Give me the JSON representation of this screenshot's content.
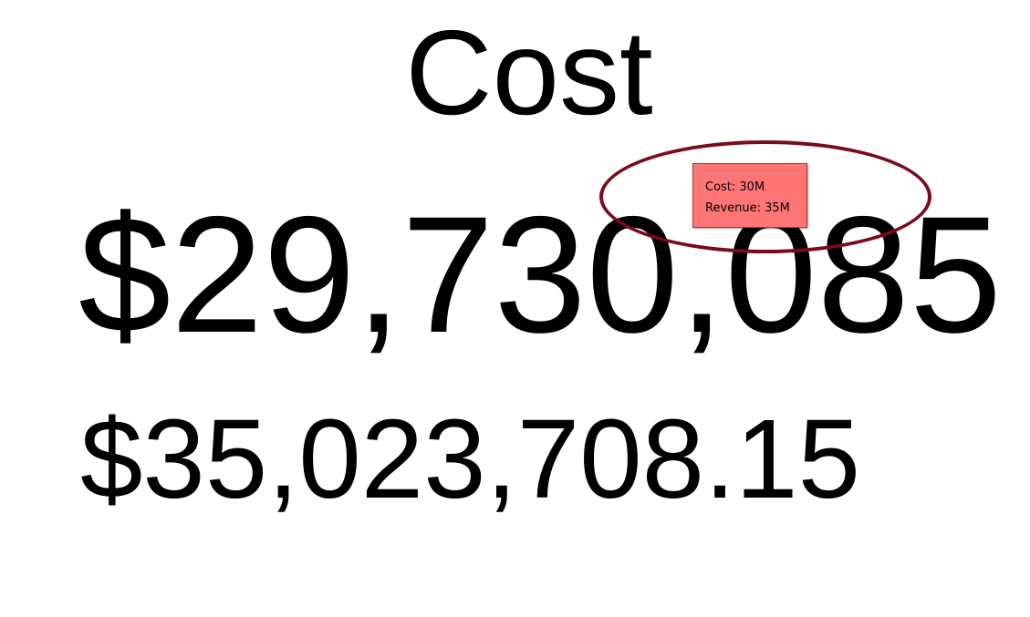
{
  "kpi": {
    "title": "Cost",
    "primary_value": "$29,730,085",
    "secondary_value": "$35,023,708.15"
  },
  "tooltip": {
    "cost_line": "Cost: 30M",
    "revenue_line": "Revenue: 35M"
  },
  "colors": {
    "tooltip_background": "#ff7575",
    "annotation_ellipse": "#7a0a1c",
    "text": "#000000",
    "background": "#ffffff"
  }
}
